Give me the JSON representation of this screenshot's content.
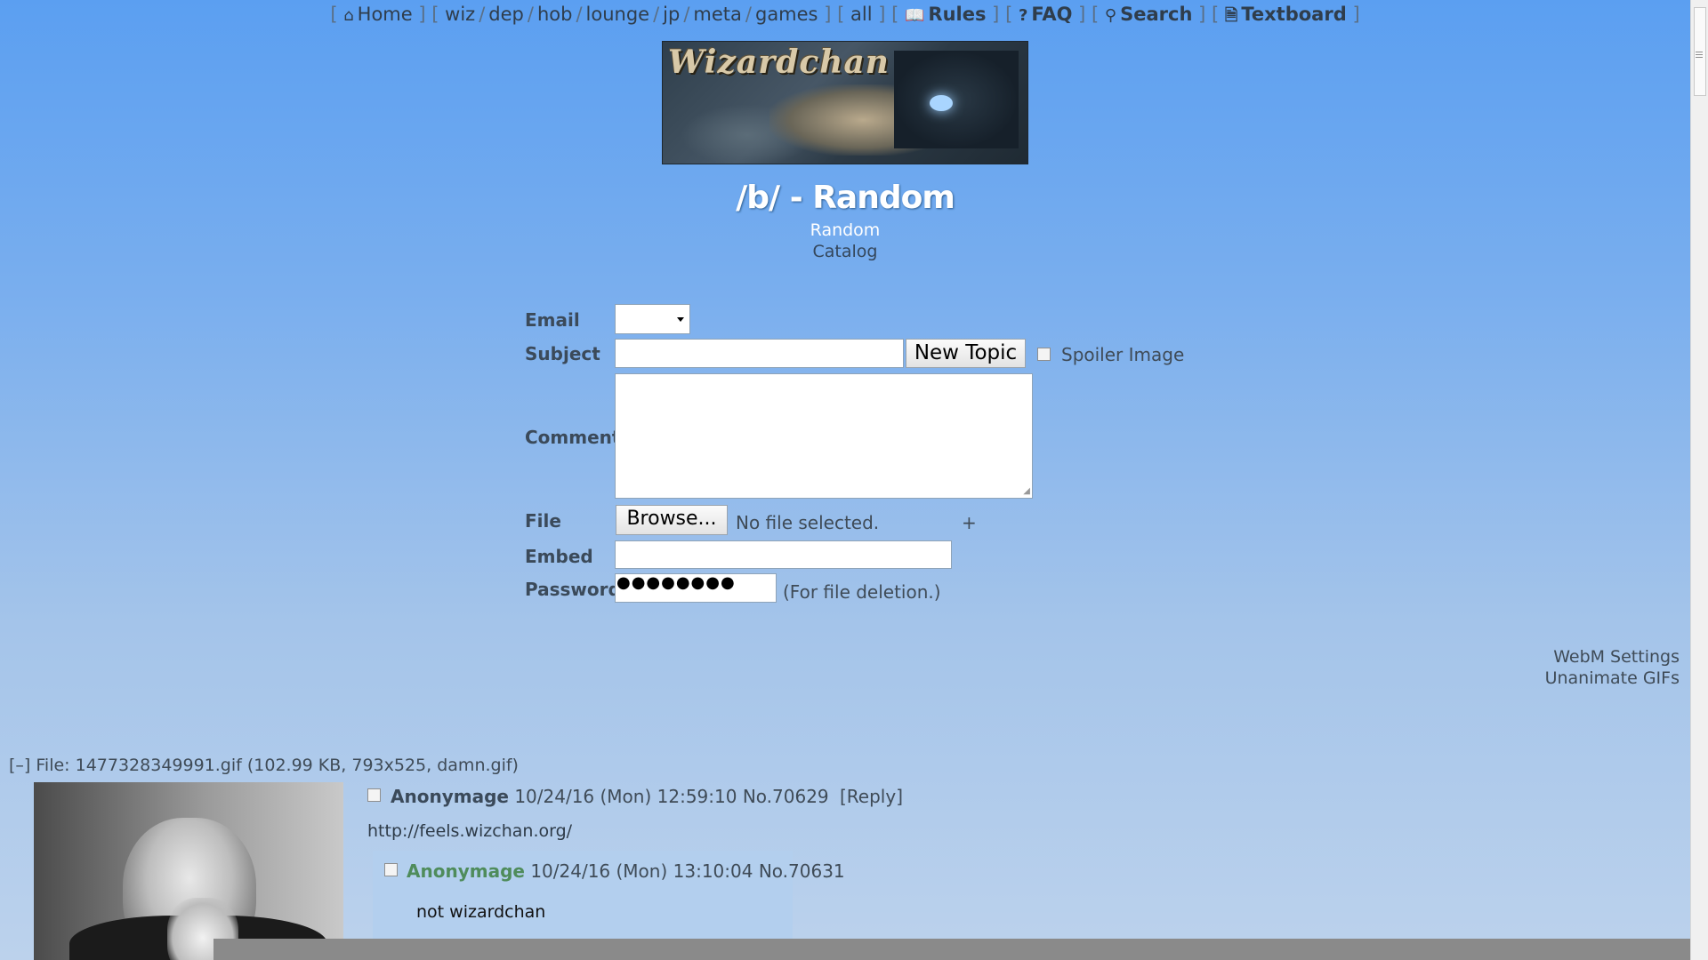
{
  "nav": {
    "home": "Home",
    "boards": [
      "wiz",
      "dep",
      "hob",
      "lounge",
      "jp",
      "meta",
      "games"
    ],
    "all": "all",
    "rules": "Rules",
    "faq": "FAQ",
    "search": "Search",
    "textboard": "Textboard"
  },
  "banner": {
    "logo_text": "Wizardchan"
  },
  "board": {
    "title": "/b/ - Random",
    "subtitle": "Random",
    "catalog": "Catalog"
  },
  "form": {
    "email_label": "Email",
    "subject_label": "Subject",
    "comment_label": "Comment",
    "file_label": "File",
    "embed_label": "Embed",
    "password_label": "Password",
    "new_topic": "New Topic",
    "spoiler": "Spoiler Image",
    "browse": "Browse...",
    "no_file": "No file selected.",
    "add_file": "+",
    "password_dots": "●●●●●●●●",
    "password_note": "(For file deletion.)"
  },
  "side": {
    "webm": "WebM Settings",
    "unanimate": "Unanimate GIFs"
  },
  "thread": {
    "file_toggle": "[–]",
    "file_info": "File: 1477328349991.gif (102.99 KB, 793x525, damn.gif)",
    "op": {
      "name": "Anonymage",
      "date": "10/24/16 (Mon) 12:59:10",
      "no": "No.70629",
      "reply": "[Reply]",
      "body": "http://feels.wizchan.org/"
    },
    "reply": {
      "name": "Anonymage",
      "date": "10/24/16 (Mon) 13:10:04",
      "no": "No.70631",
      "body": "not wizardchan"
    }
  }
}
